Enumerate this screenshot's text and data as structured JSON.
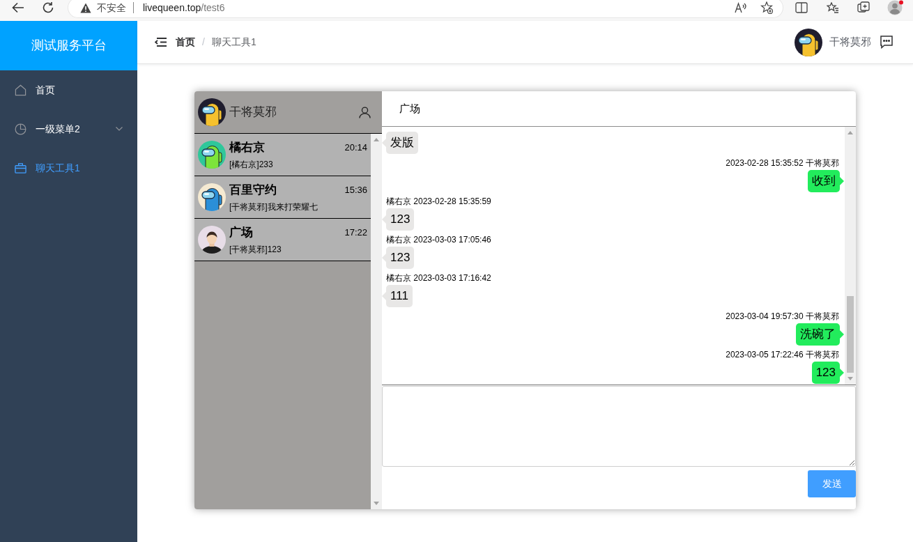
{
  "browser": {
    "security_label": "不安全",
    "url_host": "livequeen.top",
    "url_path": "/test6"
  },
  "sidebar": {
    "title": "测试服务平台",
    "items": [
      {
        "label": "首页",
        "kind": "link",
        "selected": false
      },
      {
        "label": "一级菜单2",
        "kind": "submenu",
        "selected": false
      },
      {
        "label": "聊天工具1",
        "kind": "link",
        "selected": true
      }
    ]
  },
  "header": {
    "breadcrumb": [
      {
        "label": "首页",
        "current": false
      },
      {
        "label": "聊天工具1",
        "current": true
      }
    ],
    "separator": "/",
    "user": {
      "name": "干将莫邪",
      "avatar": {
        "kind": "crewmate",
        "color": "#f5c12e",
        "backdrop": {
          "color": "#1f1d2e"
        }
      }
    }
  },
  "chat": {
    "me": {
      "name": "干将莫邪",
      "avatar": {
        "kind": "crewmate",
        "color": "#f5c12e",
        "backdrop": {
          "color": "#1f1d2e"
        }
      }
    },
    "conversations": [
      {
        "name": "橘右京",
        "time": "20:14",
        "preview": "[橘右京]233",
        "avatar": {
          "kind": "crewmate",
          "color": "#7de43b",
          "backdrop": {
            "color": "#2fc79a"
          }
        }
      },
      {
        "name": "百里守约",
        "time": "15:36",
        "preview": "[干将莫邪]我来打荣耀七",
        "avatar": {
          "kind": "crewmate",
          "color": "#2b8fd8",
          "backdrop": {
            "color": "#f5ead2"
          }
        }
      },
      {
        "name": "广场",
        "time": "17:22",
        "preview": "[干将莫邪]123",
        "avatar": {
          "kind": "person"
        }
      }
    ],
    "room": {
      "title": "广场"
    },
    "messages": [
      {
        "kind": "incoming",
        "text": "发版"
      },
      {
        "kind": "outgoing",
        "meta": "2023-02-28 15:35:52 干将莫邪",
        "text": "收到"
      },
      {
        "kind": "incoming",
        "meta": "橘右京 2023-02-28 15:35:59",
        "text": "123"
      },
      {
        "kind": "incoming",
        "meta": "橘右京 2023-03-03 17:05:46",
        "text": "123"
      },
      {
        "kind": "incoming",
        "meta": "橘右京 2023-03-03 17:16:42",
        "text": "111"
      },
      {
        "kind": "outgoing",
        "meta": "2023-03-04 19:57:30 干将莫邪",
        "text": "洗碗了"
      },
      {
        "kind": "outgoing",
        "meta": "2023-03-05 17:22:46 干将莫邪",
        "text": "123"
      }
    ],
    "send_button": "发送"
  }
}
